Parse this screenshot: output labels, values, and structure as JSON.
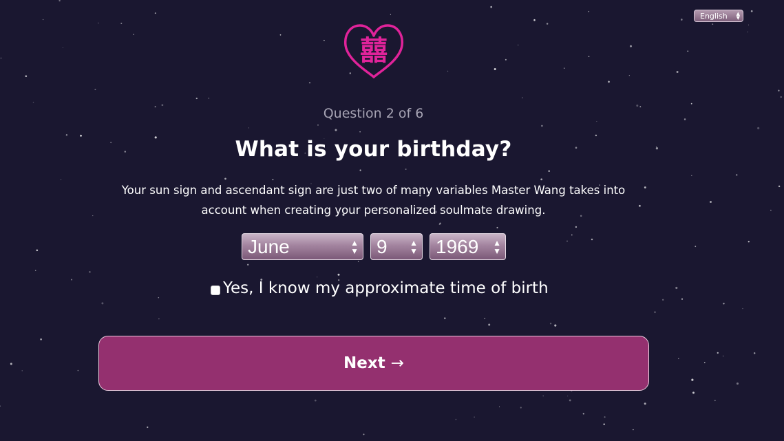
{
  "language_select": {
    "value": "English"
  },
  "logo": {
    "glyph": "囍",
    "color": "#e0239a"
  },
  "quiz": {
    "counter": "Question 2 of 6",
    "title": "What is your birthday?",
    "description": "Your sun sign and ascendant sign are just two of many variables Master Wang takes into account when creating your personalized soulmate drawing.",
    "birth_month": "June",
    "birth_day": "9",
    "birth_year": "1969",
    "time_checkbox_label": "Yes, I know my approximate time of birth",
    "time_checkbox_checked": false,
    "next_label": "Next",
    "next_arrow": "→"
  },
  "colors": {
    "background": "#1a1730",
    "accent": "#94306f",
    "logo": "#e0239a"
  }
}
